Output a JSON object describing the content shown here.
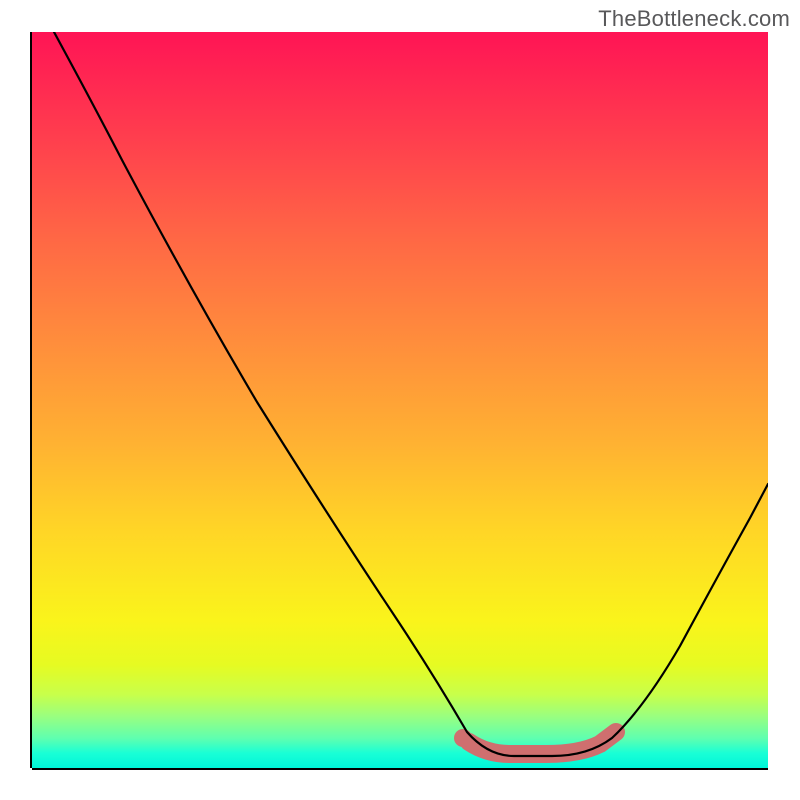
{
  "attribution": "TheBottleneck.com",
  "colors": {
    "top": "#ff1455",
    "bottom": "#00f5d9",
    "axis": "#000000",
    "curve": "#000000",
    "highlight": "#cf6f6f"
  },
  "chart_data": {
    "type": "line",
    "title": "",
    "xlabel": "",
    "ylabel": "",
    "xlim": [
      0,
      100
    ],
    "ylim": [
      0,
      100
    ],
    "series": [
      {
        "name": "bottleneck-curve",
        "x": [
          3,
          10,
          20,
          30,
          40,
          50,
          55,
          60,
          63,
          66,
          70,
          74,
          78,
          82,
          88,
          94,
          100
        ],
        "y": [
          100,
          88,
          72,
          56,
          39,
          22,
          14,
          6,
          3,
          2,
          2,
          2,
          3,
          6,
          14,
          25,
          37
        ]
      }
    ],
    "annotations": [
      {
        "name": "highlight-segment",
        "x_start": 60,
        "x_end": 80,
        "note": "thick salmon highlight along the curve near the minimum"
      }
    ]
  }
}
